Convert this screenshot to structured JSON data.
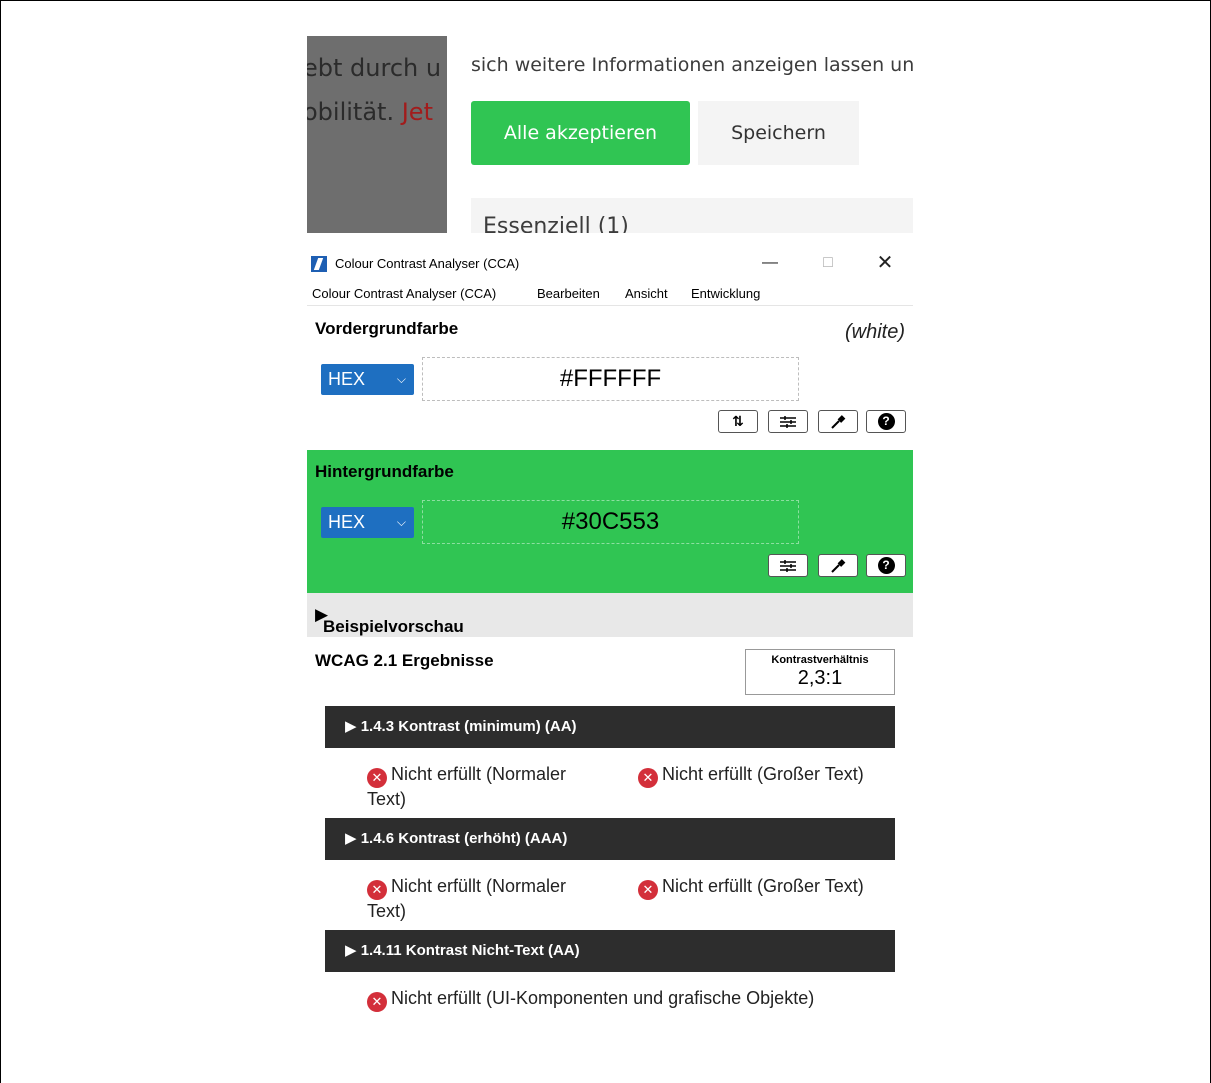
{
  "background_page": {
    "left_text_line1": "ebt durch u",
    "left_text_line2_plain": "obilität.",
    "left_text_line2_link": "Jet",
    "info_text": "sich weitere Informationen anzeigen lassen und",
    "accept_label": "Alle akzeptieren",
    "save_label": "Speichern",
    "essential_label": "Essenziell (1)"
  },
  "window": {
    "title": "Colour Contrast Analyser (CCA)",
    "minimize": "—",
    "maximize": "□",
    "close": "✕"
  },
  "menu": [
    "Colour Contrast Analyser (CCA)",
    "Bearbeiten",
    "Ansicht",
    "Entwicklung"
  ],
  "foreground": {
    "label": "Vordergrundfarbe",
    "color_name": "(white)",
    "format": "HEX",
    "value": "#FFFFFF",
    "icons": [
      "swap-icon",
      "sliders-icon",
      "eyedropper-icon",
      "help-icon"
    ]
  },
  "background": {
    "label": "Hintergrundfarbe",
    "format": "HEX",
    "value": "#30C553",
    "color": "#30c553",
    "icons": [
      "sliders-icon",
      "eyedropper-icon",
      "help-icon"
    ]
  },
  "preview": {
    "label": "Beispielvorschau"
  },
  "results": {
    "title": "WCAG 2.1 Ergebnisse",
    "ratio_label": "Kontrastverhältnis",
    "ratio_value": "2,3:1",
    "criteria": [
      {
        "title": "1.4.3 Kontrast (minimum) (AA)",
        "normal": "Nicht erfüllt (Normaler Text)",
        "large": "Nicht erfüllt (Großer Text)"
      },
      {
        "title": "1.4.6 Kontrast (erhöht) (AAA)",
        "normal": "Nicht erfüllt (Normaler Text)",
        "large": "Nicht erfüllt (Großer Text)"
      },
      {
        "title": "1.4.11 Kontrast Nicht-Text (AA)",
        "ui": "Nicht erfüllt (UI-Komponenten und grafische Objekte)"
      }
    ]
  }
}
